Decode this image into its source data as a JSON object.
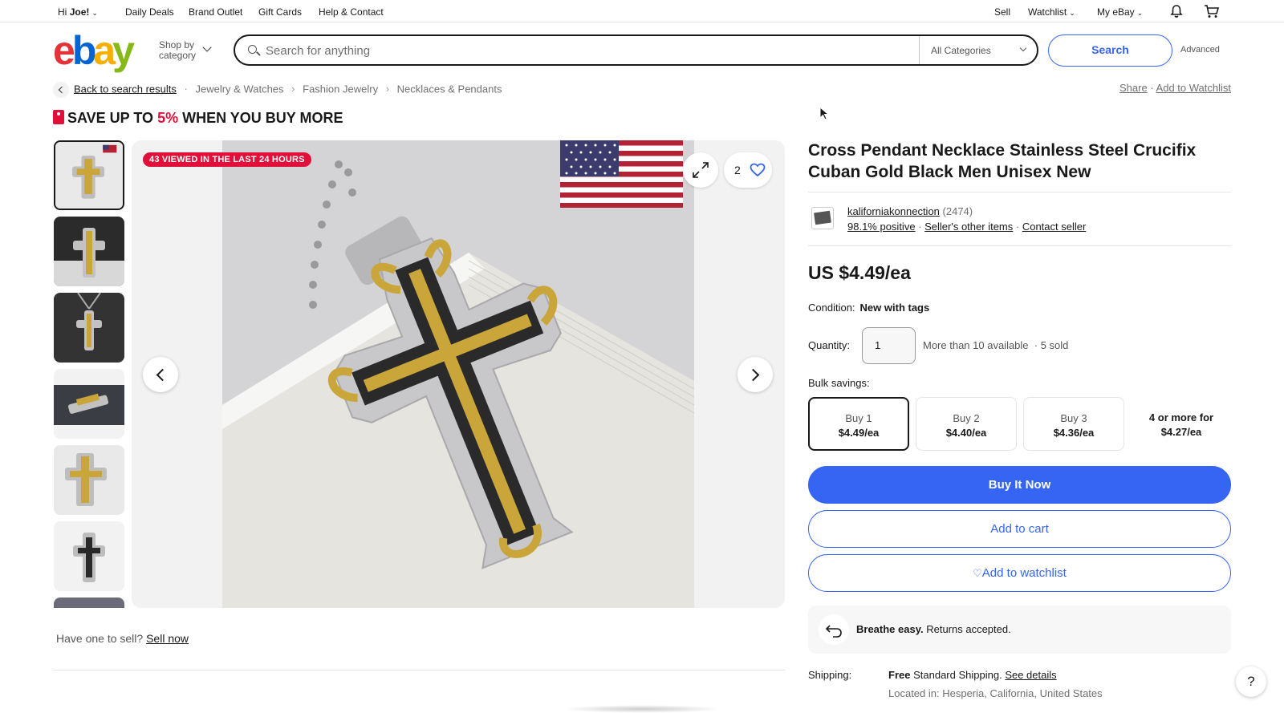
{
  "topnav": {
    "greeting_prefix": "Hi",
    "greeting_name": "Joe!",
    "links": [
      "Daily Deals",
      "Brand Outlet",
      "Gift Cards",
      "Help & Contact"
    ],
    "sell": "Sell",
    "watchlist": "Watchlist",
    "my_ebay": "My eBay"
  },
  "header": {
    "logo": {
      "e": "e",
      "b": "b",
      "a": "a",
      "y": "y"
    },
    "shop_by_line1": "Shop by",
    "shop_by_line2": "category",
    "search_placeholder": "Search for anything",
    "category": "All Categories",
    "search_button": "Search",
    "advanced": "Advanced"
  },
  "breadcrumb": {
    "back": "Back to search results",
    "items": [
      "Jewelry & Watches",
      "Fashion Jewelry",
      "Necklaces & Pendants"
    ],
    "share": "Share",
    "add_watchlist": "Add to Watchlist"
  },
  "promo": {
    "prefix": "SAVE UP TO",
    "percent": "5%",
    "suffix": "WHEN YOU BUY MORE"
  },
  "gallery": {
    "viewed_badge": "43 VIEWED IN THE LAST 24 HOURS",
    "like_count": "2"
  },
  "sell_now": {
    "prefix": "Have one to sell?",
    "link": "Sell now"
  },
  "product": {
    "title": "Cross Pendant Necklace Stainless Steel Crucifix Cuban Gold Black Men Unisex New",
    "seller": {
      "name": "kaliforniakonnection",
      "count": "(2474)",
      "positive": "98.1% positive",
      "other_items": "Seller's other items",
      "contact": "Contact seller"
    },
    "price": "US $4.49/ea",
    "condition_label": "Condition:",
    "condition": "New with tags",
    "quantity_label": "Quantity:",
    "quantity": "1",
    "available": "More than 10 available",
    "sold": "5 sold",
    "bulk_label": "Bulk savings:",
    "bulk": [
      {
        "qty": "Buy 1",
        "price": "$4.49/ea"
      },
      {
        "qty": "Buy 2",
        "price": "$4.40/ea"
      },
      {
        "qty": "Buy 3",
        "price": "$4.36/ea"
      },
      {
        "qty": "4 or more for",
        "price": "$4.27/ea"
      }
    ],
    "buy_now": "Buy It Now",
    "add_to_cart": "Add to cart",
    "add_to_watchlist": "Add to watchlist",
    "returns_bold": "Breathe easy.",
    "returns_text": "Returns accepted.",
    "shipping_label": "Shipping:",
    "shipping_free": "Free",
    "shipping_text": "Standard Shipping.",
    "shipping_link": "See details",
    "located": "Located in: Hesperia, California, United States"
  },
  "help": "?",
  "colors": {
    "accent_blue": "#3665f3",
    "badge_red": "#e0103a",
    "gold": "#c9a53a"
  }
}
